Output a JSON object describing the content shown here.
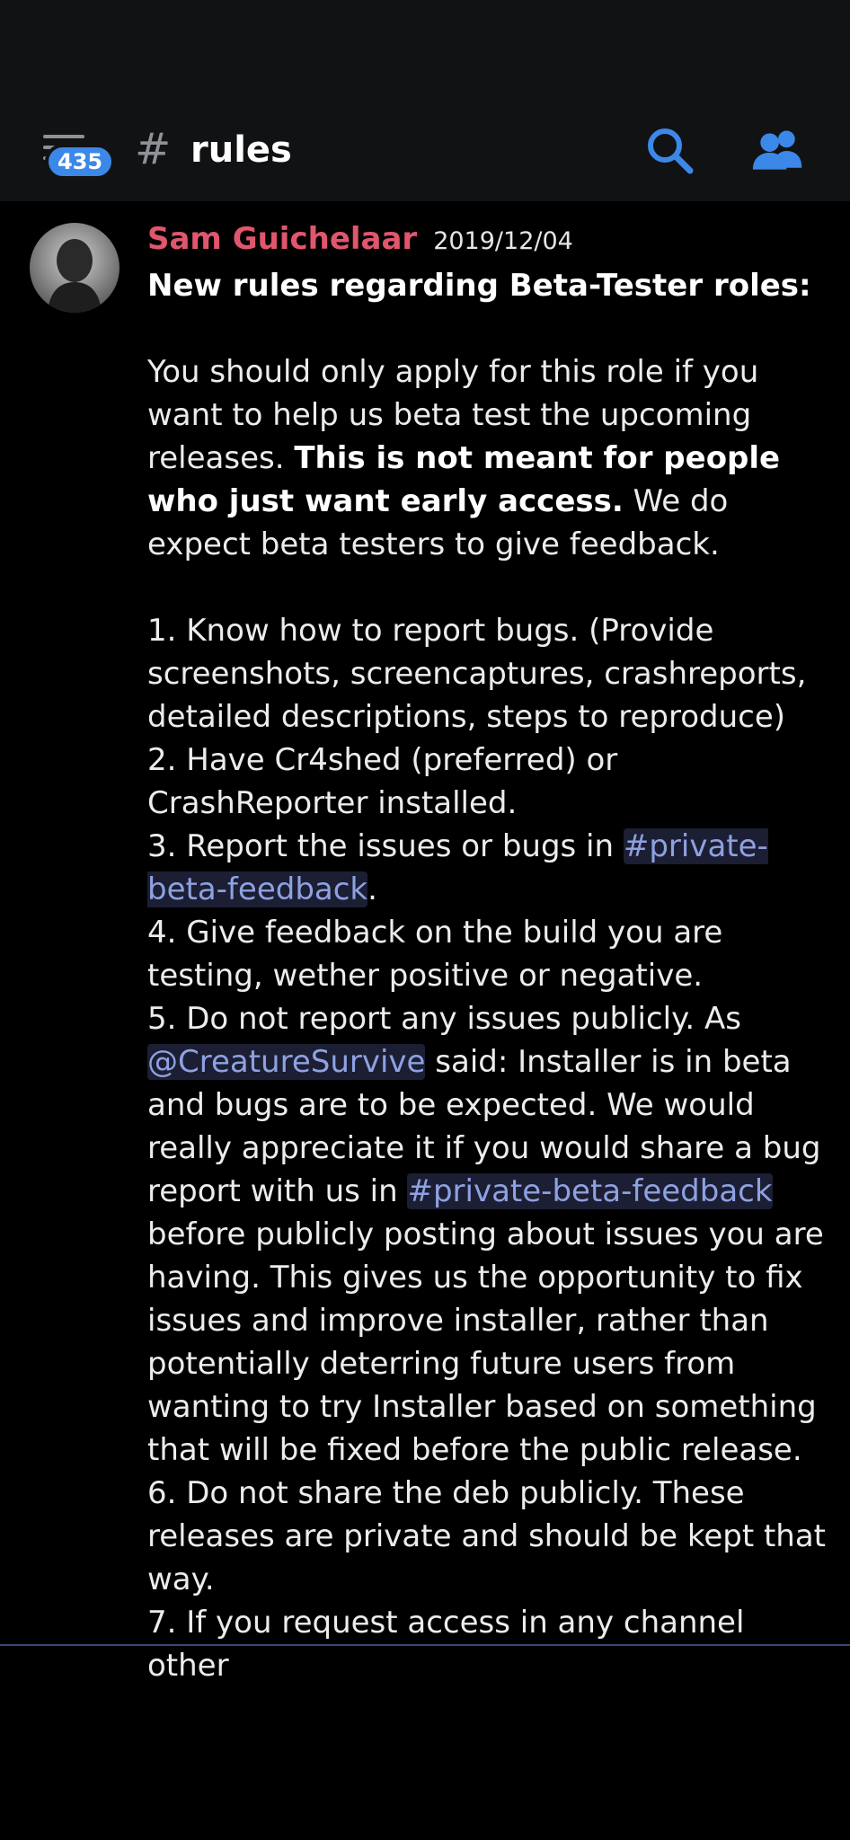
{
  "header": {
    "badge_count": "435",
    "channel_hash": "#",
    "channel_name": "rules",
    "menu_icon": "hamburger-menu-icon",
    "search_icon": "search-icon",
    "members_icon": "members-icon",
    "accent_color": "#3c88e8"
  },
  "message": {
    "author": "Sam Guichelaar",
    "author_color": "#e0566d",
    "date": "2019/12/04",
    "title": "New rules regarding Beta-Tester roles:",
    "p1_a": "You should only apply for this role if you want to help us beta test the upcoming releases. ",
    "p1_bold": "This is not meant for people who just want early access.",
    "p1_b": " We do expect beta testers to give feedback.",
    "rule1": "1. Know how to report bugs. (Provide screenshots, screencaptures, crashreports, detailed descriptions, steps to reproduce)",
    "rule2": "2. Have Cr4shed (preferred) or CrashReporter installed.",
    "rule3_a": "3. Report the issues or bugs in ",
    "rule3_channel": "#private-beta-feedback",
    "rule3_b": ".",
    "rule4": "4. Give feedback on the build you are testing, wether positive or negative.",
    "rule5_a": "5. Do not report any issues publicly. As ",
    "rule5_mention": "@CreatureSurvive",
    "rule5_b": " said: Installer is in beta and bugs are to be expected. We would really appreciate it if you would share a bug report with us in ",
    "rule5_channel": "#private-beta-feedback",
    "rule5_c": " before publicly posting about issues you are having. This gives us the opportunity to fix issues and improve installer, rather than potentially deterring future users from wanting to try Installer based on something that will be fixed before the public release.",
    "rule6": "6. Do not share the deb publicly. These releases are private and should be kept that way.",
    "rule7": "7. If you request access in any channel other"
  }
}
